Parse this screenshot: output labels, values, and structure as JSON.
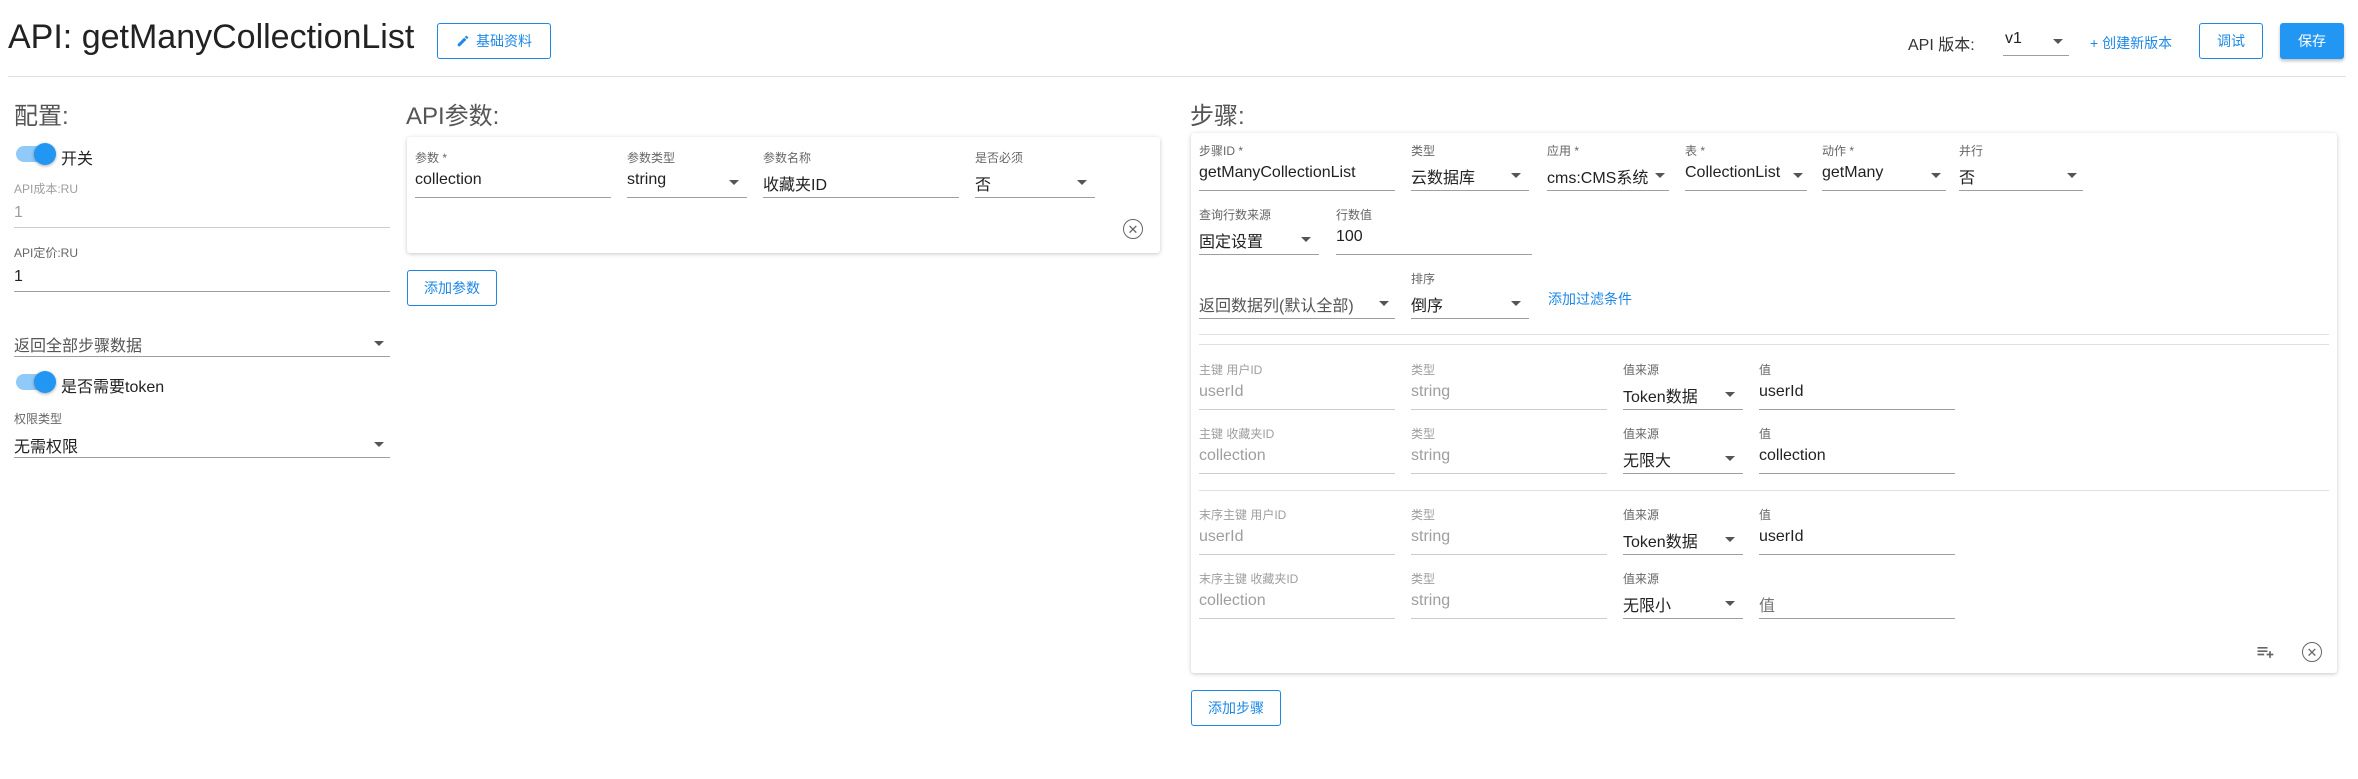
{
  "header": {
    "title": "API: getManyCollectionList",
    "basic_info_label": "基础资料",
    "version_label": "API 版本:",
    "version_value": "v1",
    "create_version_label": "+ 创建新版本",
    "debug_label": "调试",
    "save_label": "保存"
  },
  "config": {
    "title": "配置:",
    "switch_label": "开关",
    "api_cost_label": "API成本:RU",
    "api_cost_value": "1",
    "api_price_label": "API定价:RU",
    "api_price_value": "1",
    "return_select": "返回全部步骤数据",
    "token_label": "是否需要token",
    "permission_label": "权限类型",
    "permission_value": "无需权限"
  },
  "params": {
    "title": "API参数:",
    "col_param": "参数 *",
    "col_type": "参数类型",
    "col_name": "参数名称",
    "col_required": "是否必须",
    "row": {
      "param": "collection",
      "type": "string",
      "name": "收藏夹ID",
      "required": "否"
    },
    "add_label": "添加参数"
  },
  "steps": {
    "title": "步骤:",
    "step_id_label": "步骤ID *",
    "step_id_value": "getManyCollectionList",
    "type_label": "类型",
    "type_value": "云数据库",
    "app_label": "应用 *",
    "app_value": "cms:CMS系统",
    "table_label": "表 *",
    "table_value": "CollectionList",
    "action_label": "动作 *",
    "action_value": "getMany",
    "parallel_label": "并行",
    "parallel_value": "否",
    "query_source_label": "查询行数来源",
    "query_source_value": "固定设置",
    "row_count_label": "行数值",
    "row_count_value": "100",
    "return_cols_value": "返回数据列(默认全部)",
    "sort_label": "排序",
    "sort_value": "倒序",
    "add_filter_label": "添加过滤条件",
    "key_rows": [
      {
        "key_label": "主键  用户ID",
        "key_value": "userId",
        "type_label": "类型",
        "type_value": "string",
        "src_label": "值来源",
        "src_value": "Token数据",
        "val_label": "值",
        "val_value": "userId"
      },
      {
        "key_label": "主键  收藏夹ID",
        "key_value": "collection",
        "type_label": "类型",
        "type_value": "string",
        "src_label": "值来源",
        "src_value": "无限大",
        "val_label": "值",
        "val_value": "collection"
      },
      {
        "key_label": "末序主键  用户ID",
        "key_value": "userId",
        "type_label": "类型",
        "type_value": "string",
        "src_label": "值来源",
        "src_value": "Token数据",
        "val_label": "值",
        "val_value": "userId"
      },
      {
        "key_label": "末序主键  收藏夹ID",
        "key_value": "collection",
        "type_label": "类型",
        "type_value": "string",
        "src_label": "值来源",
        "src_value": "无限小",
        "val_label": "",
        "val_value": "值"
      }
    ],
    "add_step_label": "添加步骤"
  },
  "colors": {
    "accent": "#2196f3",
    "link": "#1e88e5",
    "toggle_track": "#90caf9"
  }
}
